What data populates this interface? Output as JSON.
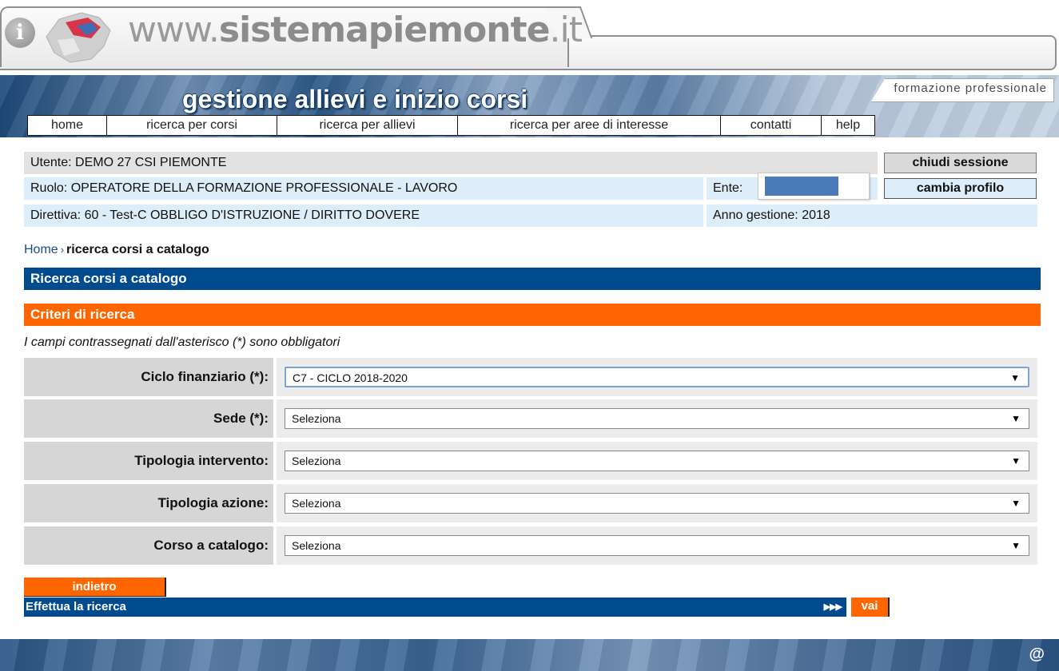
{
  "site": {
    "name_prefix": "www.",
    "name_bold": "sistemapiemonte",
    "name_suffix": ".it",
    "info_glyph": "i"
  },
  "banner": {
    "title": "gestione allievi e inizio corsi",
    "tagline": "formazione professionale"
  },
  "nav": {
    "items": [
      {
        "label": "home"
      },
      {
        "label": "ricerca per corsi"
      },
      {
        "label": "ricerca per allievi"
      },
      {
        "label": "ricerca per aree di interesse"
      },
      {
        "label": "contatti"
      },
      {
        "label": "help"
      }
    ]
  },
  "user": {
    "utente": "Utente: DEMO 27 CSI PIEMONTE",
    "ruolo": "Ruolo: OPERATORE DELLA FORMAZIONE PROFESSIONALE - LAVORO",
    "ente_label": "Ente:",
    "direttiva": "Direttiva: 60 - Test-C OBBLIGO D'ISTRUZIONE / DIRITTO DOVERE",
    "anno_gestione": "Anno gestione: 2018",
    "close_session_label": "chiudi sessione",
    "change_profile_label": "cambia profilo"
  },
  "breadcrumb": {
    "home": "Home",
    "separator": "›",
    "current": "ricerca corsi a catalogo"
  },
  "page": {
    "title": "Ricerca corsi a catalogo",
    "section_title": "Criteri di ricerca",
    "required_note": "I campi contrassegnati dall'asterisco (*) sono obbligatori"
  },
  "form": {
    "fields": [
      {
        "label": "Ciclo finanziario (*):",
        "value": "C7 - CICLO 2018-2020"
      },
      {
        "label": "Sede (*):",
        "value": "Seleziona"
      },
      {
        "label": "Tipologia intervento:",
        "value": "Seleziona"
      },
      {
        "label": "Tipologia azione:",
        "value": "Seleziona"
      },
      {
        "label": "Corso a catalogo:",
        "value": "Seleziona"
      }
    ],
    "caret": "▼",
    "back_label": "indietro",
    "submit_text": "Effettua la ricerca",
    "submit_arrows": "▶▶▶",
    "go_label": "vai"
  },
  "footer": {
    "contact_glyph": "@"
  },
  "colors": {
    "blue_bar": "#004b8d",
    "orange_bar": "#ff6600",
    "info_row": "#ddeefa",
    "user_row": "#e2e2e2"
  }
}
